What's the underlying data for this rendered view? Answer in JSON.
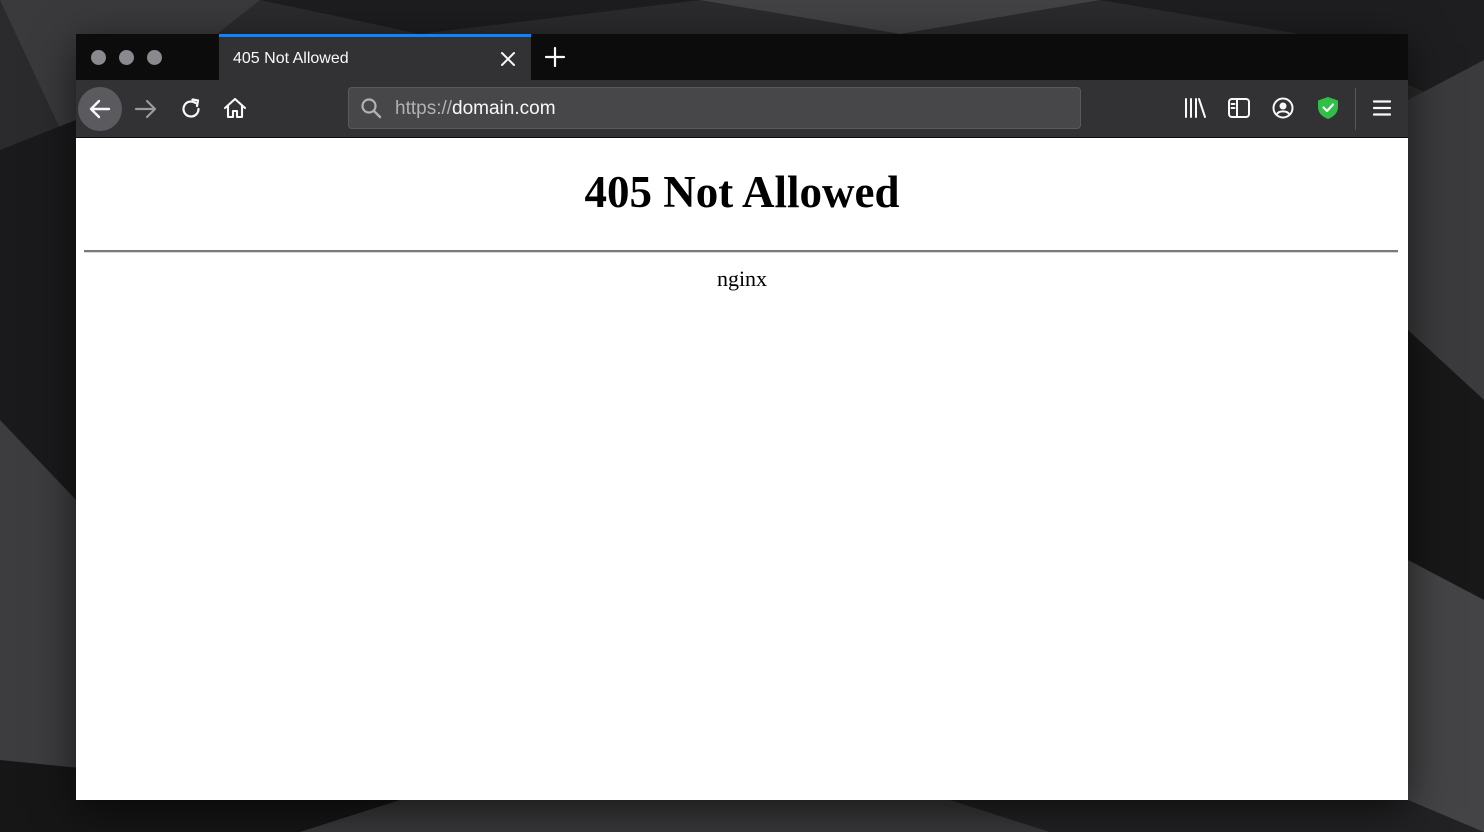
{
  "browser": {
    "tab": {
      "title": "405 Not Allowed"
    },
    "urlbar": {
      "scheme": "https://",
      "host": "domain.com"
    },
    "toolbar_icons": [
      "back-icon",
      "forward-icon",
      "reload-icon",
      "home-icon",
      "library-icon",
      "sidebar-icon",
      "account-icon",
      "shield-icon",
      "menu-icon"
    ],
    "accent_color": "#0a84ff",
    "shield_color": "#30c04a"
  },
  "page": {
    "heading": "405 Not Allowed",
    "server": "nginx"
  }
}
